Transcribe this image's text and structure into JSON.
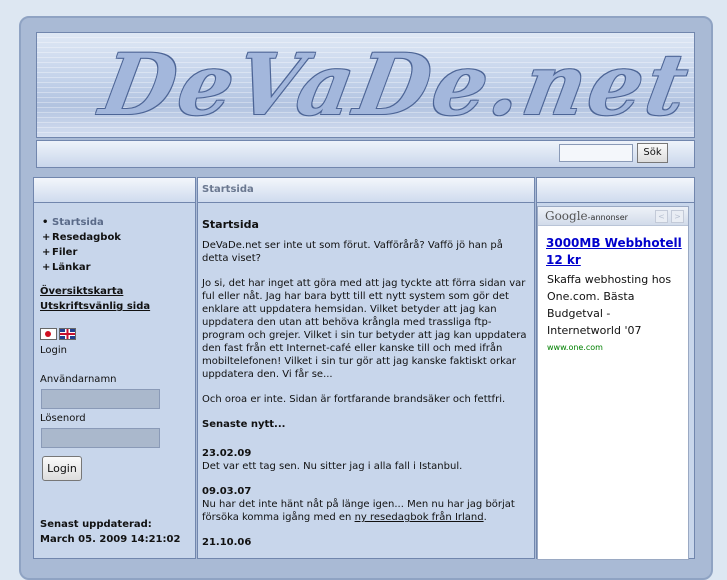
{
  "site": {
    "logo_text": "DeVaDe.net"
  },
  "search": {
    "button_label": "Sök"
  },
  "nav": {
    "items": [
      {
        "label": "Startsida",
        "active": true
      },
      {
        "label": "Resedagbok",
        "active": false
      },
      {
        "label": "Filer",
        "active": false
      },
      {
        "label": "Länkar",
        "active": false
      }
    ],
    "sitemap_link": "Översiktskarta",
    "print_link": "Utskriftsvänlig sida"
  },
  "login": {
    "title": "Login",
    "username_label": "Användarnamn",
    "password_label": "Lösenord",
    "button_label": "Login"
  },
  "updated": {
    "label": "Senast uppdaterad:",
    "value": "March 05. 2009 14:21:02"
  },
  "breadcrumb": "Startsida",
  "main": {
    "heading": "Startsida",
    "intro": "DeVaDe.net ser inte ut som förut. Vafförårå? Vaffö jö han på detta viset?",
    "para2": "Jo si, det har inget att göra med att jag tyckte att förra sidan var ful eller nåt. Jag har bara bytt till ett nytt system som gör det enklare att uppdatera hemsidan. Vilket betyder att jag kan uppdatera den utan att behöva krångla med trassliga ftp-program och grejer. Vilket i sin tur betyder att jag kan uppdatera den fast från ett Internet-café eller kanske till och med ifrån mobiltelefonen! Vilket i sin tur gör att jag kanske faktiskt orkar uppdatera den. Vi får se...",
    "para3": "Och oroa er inte. Sidan är fortfarande brandsäker och fettfri.",
    "latest_heading": "Senaste nytt...",
    "news": [
      {
        "date": "23.02.09",
        "text": "Det var ett tag sen. Nu sitter jag i alla fall i Istanbul."
      },
      {
        "date": "09.03.07",
        "text": "Nu har det inte hänt nåt på länge igen... Men nu har jag börjat försöka komma igång med en ",
        "link": "ny resedagbok från Irland",
        "after": "."
      },
      {
        "date": "21.10.06"
      }
    ]
  },
  "ad": {
    "brand": "Google",
    "brand_suffix": "-annonser",
    "prev_arrow": "<",
    "next_arrow": ">",
    "title": "3000MB Webbhotell 12 kr",
    "text": "Skaffa webhosting hos One.com. Bästa Budgetval - Internetworld '07",
    "url": "www.one.com"
  }
}
